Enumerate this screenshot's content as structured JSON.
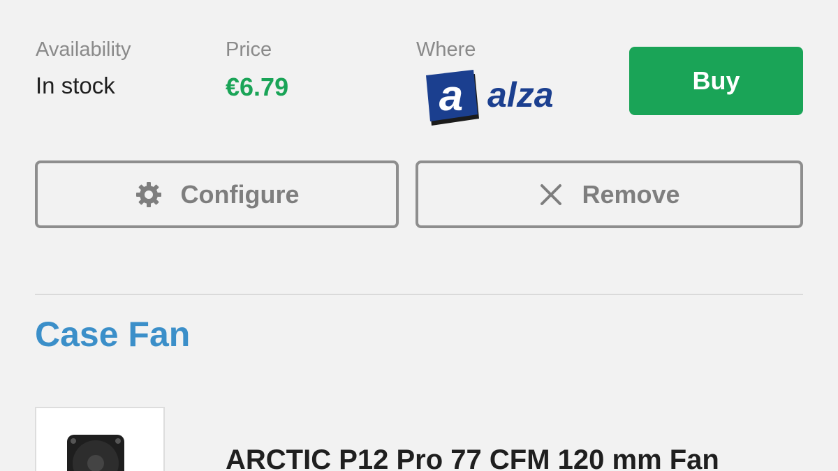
{
  "listing": {
    "availability_label": "Availability",
    "availability_value": "In stock",
    "price_label": "Price",
    "price_value": "€6.79",
    "where_label": "Where",
    "store_logo": "alza",
    "buy_label": "Buy"
  },
  "actions": {
    "configure_label": "Configure",
    "configure_icon": "gear-icon",
    "remove_label": "Remove",
    "remove_icon": "close-icon"
  },
  "section": {
    "title": "Case Fan",
    "product_name": "ARCTIC P12 Pro 77 CFM 120 mm Fan",
    "product_image": "fan-thumbnail"
  },
  "colors": {
    "accent_green": "#1aa457",
    "section_blue": "#3b8fc9",
    "logo_blue": "#1b3f8f"
  }
}
